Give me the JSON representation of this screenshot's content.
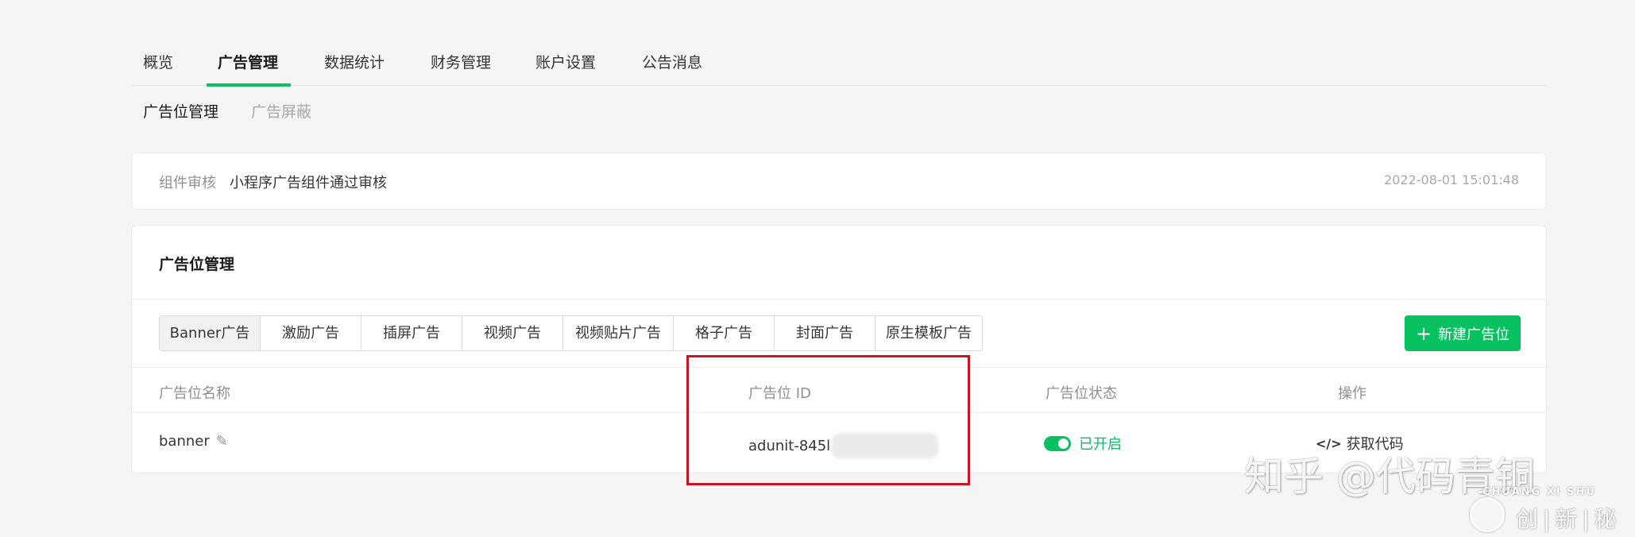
{
  "nav": {
    "tabs": [
      {
        "label": "概览"
      },
      {
        "label": "广告管理"
      },
      {
        "label": "数据统计"
      },
      {
        "label": "财务管理"
      },
      {
        "label": "账户设置"
      },
      {
        "label": "公告消息"
      }
    ],
    "active_index": 1
  },
  "subnav": {
    "items": [
      {
        "label": "广告位管理"
      },
      {
        "label": "广告屏蔽"
      }
    ]
  },
  "notice": {
    "label": "组件审核",
    "message": "小程序广告组件通过审核",
    "time": "2022-08-01 15:01:48"
  },
  "panel": {
    "title": "广告位管理",
    "ad_types": [
      "Banner广告",
      "激励广告",
      "插屏广告",
      "视频广告",
      "视频贴片广告",
      "格子广告",
      "封面广告",
      "原生模板广告"
    ],
    "new_button": {
      "icon": "+",
      "label": "新建广告位"
    },
    "table": {
      "headers": [
        "广告位名称",
        "广告位 ID",
        "广告位状态",
        "操作"
      ],
      "rows": [
        {
          "name": "banner",
          "id_prefix": "adunit-845l",
          "status": "已开启",
          "action_icon": "</>",
          "action": "获取代码"
        }
      ]
    }
  },
  "watermark": {
    "text": "知乎 @代码青铜",
    "logo_en": "CHUANG XI SHU",
    "logo_cn": "创|新|秘"
  },
  "colors": {
    "accent": "#07c160",
    "highlight_box": "#c8161e"
  }
}
